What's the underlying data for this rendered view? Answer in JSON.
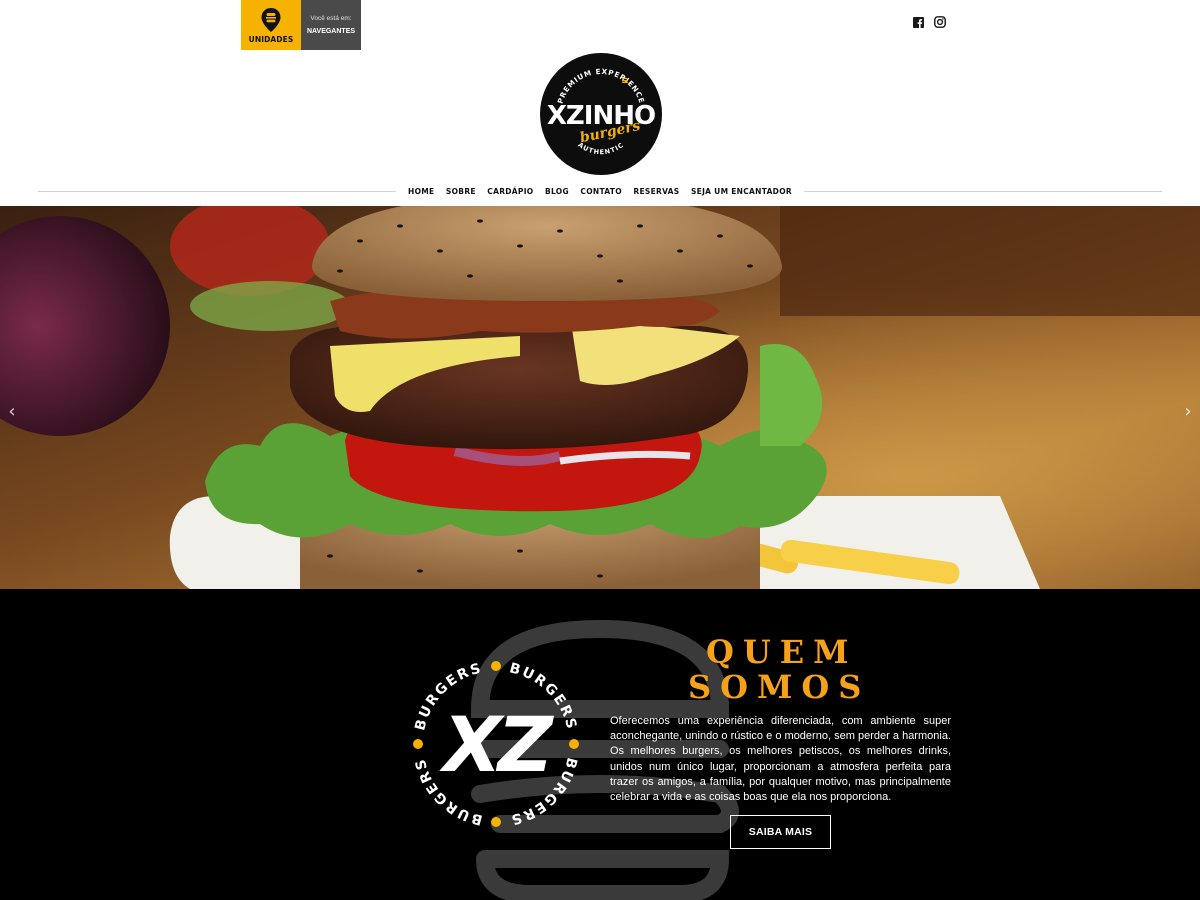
{
  "topbar": {
    "units_label": "UNIDADES",
    "location_prefix": "Você está em:",
    "location_city": "NAVEGANTES"
  },
  "social": [
    {
      "name": "facebook-icon"
    },
    {
      "name": "instagram-icon"
    }
  ],
  "logo": {
    "top_text": "PREMIUM EXPERIENCE",
    "brand": "XZINHO",
    "sub": "burgers",
    "bottom_text": "AUTHENTIC"
  },
  "nav": {
    "items": [
      "HOME",
      "SOBRE",
      "CARDÁPIO",
      "BLOG",
      "CONTATO",
      "RESERVAS",
      "SEJA UM ENCANTADOR"
    ]
  },
  "hero": {
    "prev_arrow": "‹",
    "next_arrow": "›"
  },
  "about": {
    "title_line1": "QUEM",
    "title_line2": "SOMOS",
    "text": "Oferecemos uma experiência diferenciada, com ambiente super aconchegante, unindo o rústico e o moderno, sem perder a harmonia. Os melhores burgers, os melhores petiscos, os melhores drinks, unidos num único lugar, proporcionam a atmosfera perfeita para trazer os amigos, a família, por qualquer motivo, mas principalmente celebrar a vida e as coisas boas que ela nos proporciona.",
    "button": "SAIBA MAIS",
    "badge_center": "XZ",
    "badge_ring_word": "BURGERS"
  },
  "colors": {
    "accent": "#f5b200",
    "title_orange": "#f5a21a",
    "dark_box": "#4a4a4a",
    "black": "#000000"
  }
}
